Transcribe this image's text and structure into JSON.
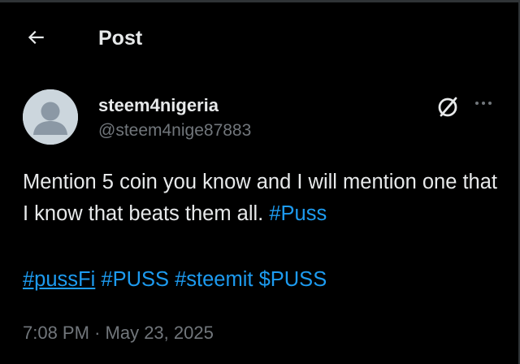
{
  "colors": {
    "background": "#000000",
    "text_primary": "#e7e9ea",
    "text_secondary": "#71767b",
    "link": "#1d9bf0",
    "avatar_bg": "#ccd6dd",
    "avatar_fg": "#8b98a5"
  },
  "header": {
    "back_icon": "arrow-left-icon",
    "title": "Post"
  },
  "author": {
    "avatar_icon": "default-avatar-icon",
    "display_name": "steem4nigeria",
    "handle": "@steem4nige87883"
  },
  "actions": {
    "grok_icon": "grok-icon",
    "more_icon": "more-dots-icon"
  },
  "tweet": {
    "text_before_tag": "Mention 5 coin you know and I will mention one that I know that beats them all. ",
    "inline_tag": "#Puss",
    "tags": [
      "#pussFi",
      "#PUSS",
      "#steemit",
      "$PUSS"
    ]
  },
  "meta": {
    "time": "7:08 PM",
    "separator": "·",
    "date": "May 23, 2025"
  }
}
